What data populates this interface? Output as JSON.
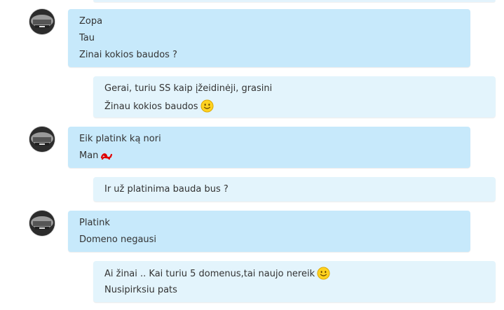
{
  "messages": [
    {
      "lines": [
        "Zopa",
        "Tau",
        "Zinai kokios baudos ?"
      ]
    },
    {
      "lines": [
        "Gerai, turiu SS kaip įžeidinėji, grasini",
        "Žinau kokios baudos"
      ]
    },
    {
      "lines": [
        "Eik platink ką nori",
        "Man"
      ]
    },
    {
      "lines": [
        "Ir už platinima bauda bus ?"
      ]
    },
    {
      "lines": [
        "Platink",
        "Domeno negausi"
      ]
    },
    {
      "lines": [
        "Ai žinai .. Kai turiu 5 domenus,tai naujo nereik",
        "Nusipirksiu pats"
      ]
    }
  ],
  "icons": {
    "smile": "smile-emoji-icon",
    "scribble": "red-scribble-redaction"
  },
  "colors": {
    "incoming_bubble": "#c7e9fb",
    "outgoing_bubble": "#e3f4fc",
    "text": "#333333",
    "emoji_yellow": "#ffd21f"
  }
}
